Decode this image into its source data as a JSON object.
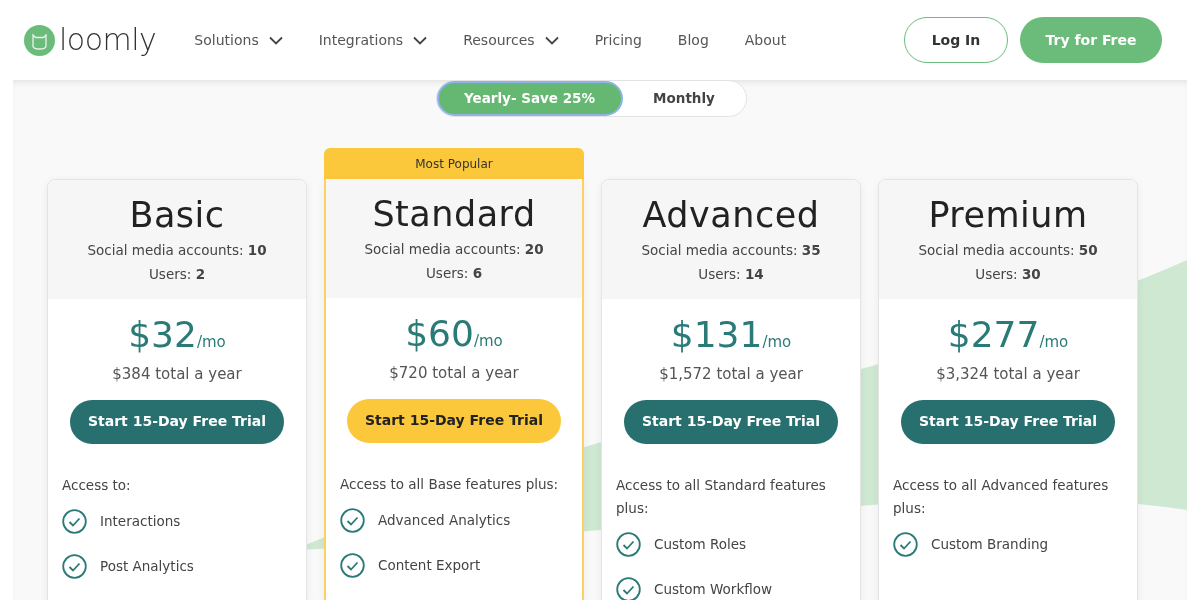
{
  "header": {
    "logo_text": "loomly",
    "nav": [
      {
        "label": "Solutions",
        "has_menu": true
      },
      {
        "label": "Integrations",
        "has_menu": true
      },
      {
        "label": "Resources",
        "has_menu": true
      },
      {
        "label": "Pricing",
        "has_menu": false
      },
      {
        "label": "Blog",
        "has_menu": false
      },
      {
        "label": "About",
        "has_menu": false
      }
    ],
    "buttons": [
      {
        "label": "Log In",
        "kind": "outline"
      },
      {
        "label": "Try for Free",
        "kind": "filled"
      }
    ]
  },
  "billing_toggle": [
    {
      "label": "Yearly- Save 25%",
      "selected": true
    },
    {
      "label": "Monthly",
      "selected": false
    }
  ],
  "plans": [
    {
      "name": "Basic",
      "accounts": "Social media accounts: **10**",
      "users": "Users: **2**",
      "price": "$32",
      "per": "/mo",
      "yearly": "$384 total a year",
      "button": {
        "label": "Start 15-Day Free Trial",
        "kind": "primary"
      },
      "access_heading": "Access to:",
      "features": [
        "Interactions",
        "Post Analytics"
      ]
    },
    {
      "name": "Standard",
      "badge": "Most Popular",
      "accounts": "Social media accounts: **20**",
      "users": "Users: **6**",
      "price": "$60",
      "per": "/mo",
      "yearly": "$720 total a year",
      "button": {
        "label": "Start 15-Day Free Trial",
        "kind": "highlight"
      },
      "access_heading": "Access to all Base features plus:",
      "features": [
        "Advanced Analytics",
        "Content Export"
      ]
    },
    {
      "name": "Advanced",
      "accounts": "Social media accounts: **35**",
      "users": "Users: **14**",
      "price": "$131",
      "per": "/mo",
      "yearly": "$1,572 total a year",
      "button": {
        "label": "Start 15-Day Free Trial",
        "kind": "primary"
      },
      "access_heading": "Access to all Standard features plus:",
      "features": [
        "Custom Roles",
        "Custom Workflow"
      ]
    },
    {
      "name": "Premium",
      "accounts": "Social media accounts: **50**",
      "users": "Users: **30**",
      "price": "$277",
      "per": "/mo",
      "yearly": "$3,324 total a year",
      "button": {
        "label": "Start 15-Day Free Trial",
        "kind": "primary"
      },
      "access_heading": "Access to all Advanced features plus:",
      "features": [
        "Custom Branding"
      ]
    }
  ]
}
